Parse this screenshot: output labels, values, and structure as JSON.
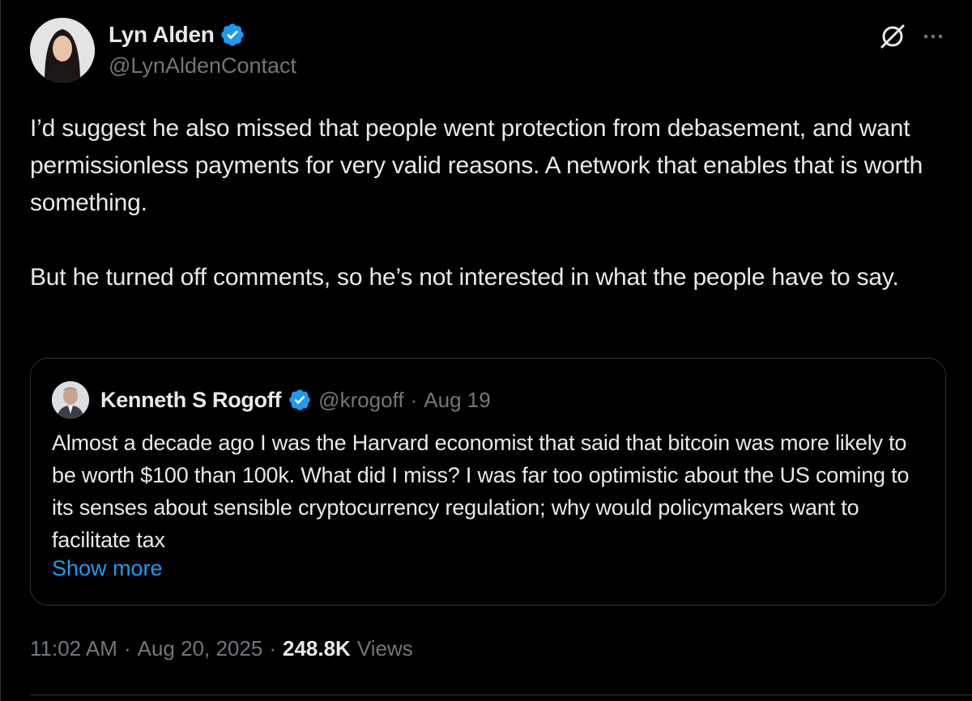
{
  "author": {
    "display_name": "Lyn Alden",
    "handle": "@LynAldenContact",
    "verified_icon": "verified-badge-icon"
  },
  "header_actions": {
    "grok_icon": "grok-icon",
    "more_icon": "more-icon"
  },
  "tweet": {
    "paragraphs": [
      "I’d suggest he also missed that people went protection from debasement, and want permissionless payments for very valid reasons. A network that enables that is worth something.",
      "But he turned off comments, so he’s not interested in what the people have to say."
    ]
  },
  "quote": {
    "display_name": "Kenneth S Rogoff",
    "handle": "@krogoff",
    "separator": "·",
    "date": "Aug 19",
    "text": "Almost a decade ago I was the Harvard economist that said that bitcoin was more likely to be worth $100 than 100k.  What did I miss? I was far too optimistic about the US coming to its senses about sensible cryptocurrency regulation; why would policymakers want to facilitate tax",
    "show_more": "Show more"
  },
  "meta": {
    "time": "11:02 AM",
    "sep1": "·",
    "date": "Aug 20, 2025",
    "sep2": "·",
    "views_count": "248.8K",
    "views_label": "Views"
  },
  "colors": {
    "background": "#000000",
    "text": "#e7e9ea",
    "secondary": "#71767b",
    "accent": "#1d9bf0",
    "border": "#2f3336"
  }
}
